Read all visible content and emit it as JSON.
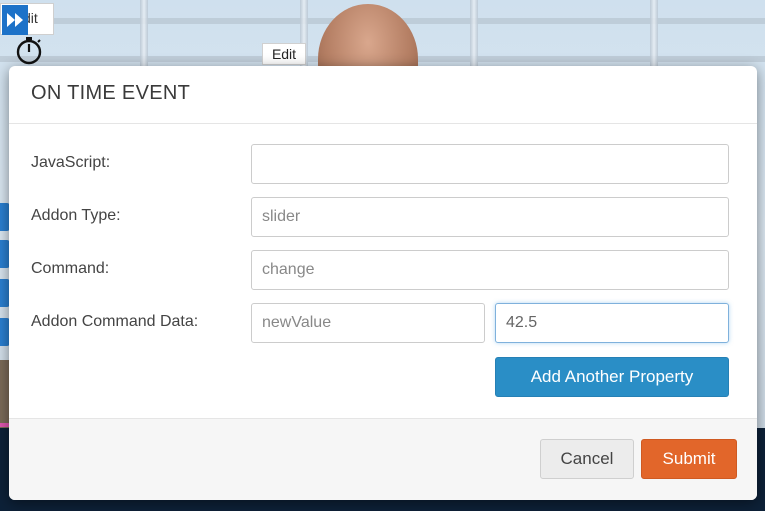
{
  "toolbar": {
    "edit_label_partial": "dit",
    "skip_icon": "fast-forward-icon",
    "timer_icon": "stopwatch-icon",
    "edit_tag": "Edit"
  },
  "modal": {
    "title": "ON TIME EVENT",
    "fields": {
      "javascript": {
        "label": "JavaScript:",
        "value": ""
      },
      "addon_type": {
        "label": "Addon Type:",
        "value": "slider"
      },
      "command": {
        "label": "Command:",
        "value": "change"
      },
      "addon_command_data": {
        "label": "Addon Command Data:",
        "key": "newValue",
        "value": "42.5"
      }
    },
    "add_property_label": "Add Another Property",
    "cancel_label": "Cancel",
    "submit_label": "Submit"
  },
  "colors": {
    "primary_blue": "#2a8ec6",
    "submit_orange": "#e2662a",
    "toolbar_blue": "#1d72c8"
  }
}
